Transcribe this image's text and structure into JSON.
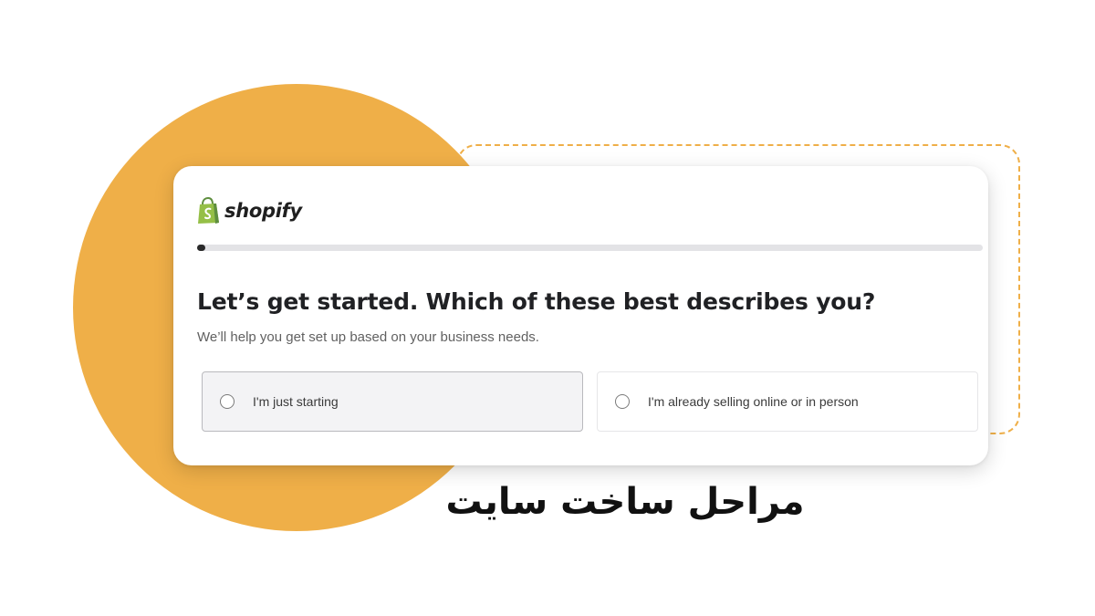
{
  "brand": {
    "name": "shopify",
    "icon": "shopping-bag-icon",
    "icon_color": "#95bf47"
  },
  "onboarding": {
    "progress_fraction": 0.01,
    "heading": "Let’s get started. Which of these best describes you?",
    "subheading": "We’ll help you get set up based on your business needs.",
    "options": [
      {
        "label": "I'm just starting",
        "selected": false
      },
      {
        "label": "I'm already selling online or in person",
        "selected": false
      }
    ]
  },
  "caption": "مراحل ساخت سایت",
  "colors": {
    "accent": "#efaf48",
    "heading": "#202124",
    "progress_fill": "#2a2a2a",
    "progress_track": "#e3e3e6"
  }
}
